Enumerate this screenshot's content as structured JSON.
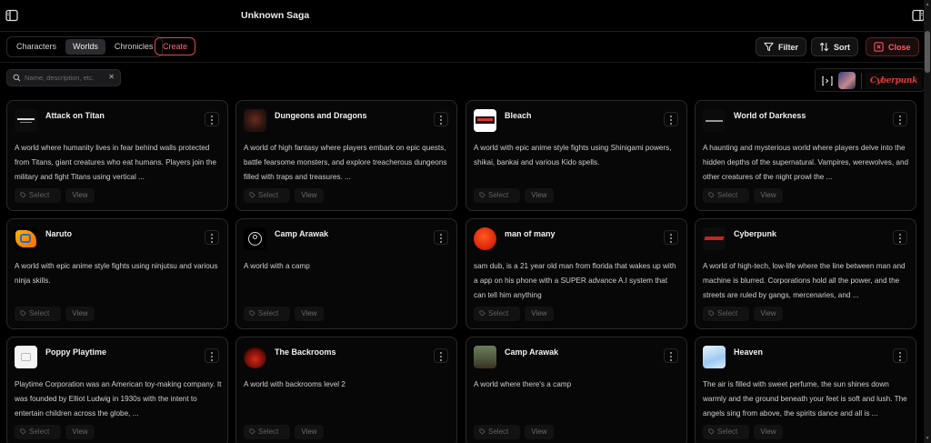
{
  "app": {
    "title": "Unknown Saga"
  },
  "tabs": [
    {
      "label": "Characters",
      "active": false
    },
    {
      "label": "Worlds",
      "active": true
    },
    {
      "label": "Chronicles",
      "active": false
    }
  ],
  "toolbar": {
    "create_label": "Create",
    "filter_label": "Filter",
    "sort_label": "Sort",
    "close_label": "Close",
    "accent_color": "#e0474c"
  },
  "search": {
    "placeholder": "Name, description, etc.",
    "value": ""
  },
  "brand": {
    "logo_text": "Cyberpunk"
  },
  "cards": [
    {
      "title": "Attack on Titan",
      "thumb": "titan",
      "description": "A world where humanity lives in fear behind walls protected from Titans, giant creatures who eat humans. Players join the military and fight Titans using vertical ...",
      "select_label": "Select",
      "view_label": "View"
    },
    {
      "title": "Dungeons and Dragons",
      "thumb": "dnd",
      "description": "A world of high fantasy where players embark on epic quests, battle fearsome monsters, and explore treacherous dungeons filled with traps and treasures. ...",
      "select_label": "Select",
      "view_label": "View"
    },
    {
      "title": "Bleach",
      "thumb": "bleach",
      "description": "A world with epic anime style fights using Shinigami powers, shikai, bankai and various Kido spells.",
      "select_label": "Select",
      "view_label": "View"
    },
    {
      "title": "World of Darkness",
      "thumb": "wod",
      "description": "A haunting and mysterious world where players delve into the hidden depths of the supernatural. Vampires, werewolves, and other creatures of the night prowl the ...",
      "select_label": "Select",
      "view_label": "View"
    },
    {
      "title": "Naruto",
      "thumb": "naruto",
      "description": "A world with epic anime style fights using ninjutsu and various ninja skills.",
      "select_label": "Select",
      "view_label": "View"
    },
    {
      "title": "Camp Arawak",
      "thumb": "camp",
      "description": "A world with a camp",
      "select_label": "Select",
      "view_label": "View"
    },
    {
      "title": "man of many",
      "thumb": "man",
      "description": "sam dub, is a 21 year old  man from florida that wakes up with a app on his phone with a SUPER advance A.I system that can tell him anything",
      "select_label": "Select",
      "view_label": "View"
    },
    {
      "title": "Cyberpunk",
      "thumb": "cyber",
      "description": "A world of high-tech, low-life where the line between man and machine is blurred. Corporations hold all the power, and the streets are ruled by gangs, mercenaries, and ...",
      "select_label": "Select",
      "view_label": "View"
    },
    {
      "title": "Poppy Playtime",
      "thumb": "poppy",
      "description": "Playtime Corporation was an American toy-making company. It was founded by Elliot Ludwig in 1930s with the intent to entertain children across the globe, ...",
      "select_label": "Select",
      "view_label": "View"
    },
    {
      "title": "The Backrooms",
      "thumb": "back",
      "description": "A world with backrooms level 2",
      "select_label": "Select",
      "view_label": "View"
    },
    {
      "title": "Camp Arawak",
      "thumb": "camp2",
      "description": "A world where there's a camp",
      "select_label": "Select",
      "view_label": "View"
    },
    {
      "title": "Heaven",
      "thumb": "heaven",
      "description": "The air is filled with sweet perfume, the sun shines down warmly and the ground beneath your feet is soft and lush. The angels sing from above, the spirits dance and all is ...",
      "select_label": "Select",
      "view_label": "View"
    }
  ]
}
